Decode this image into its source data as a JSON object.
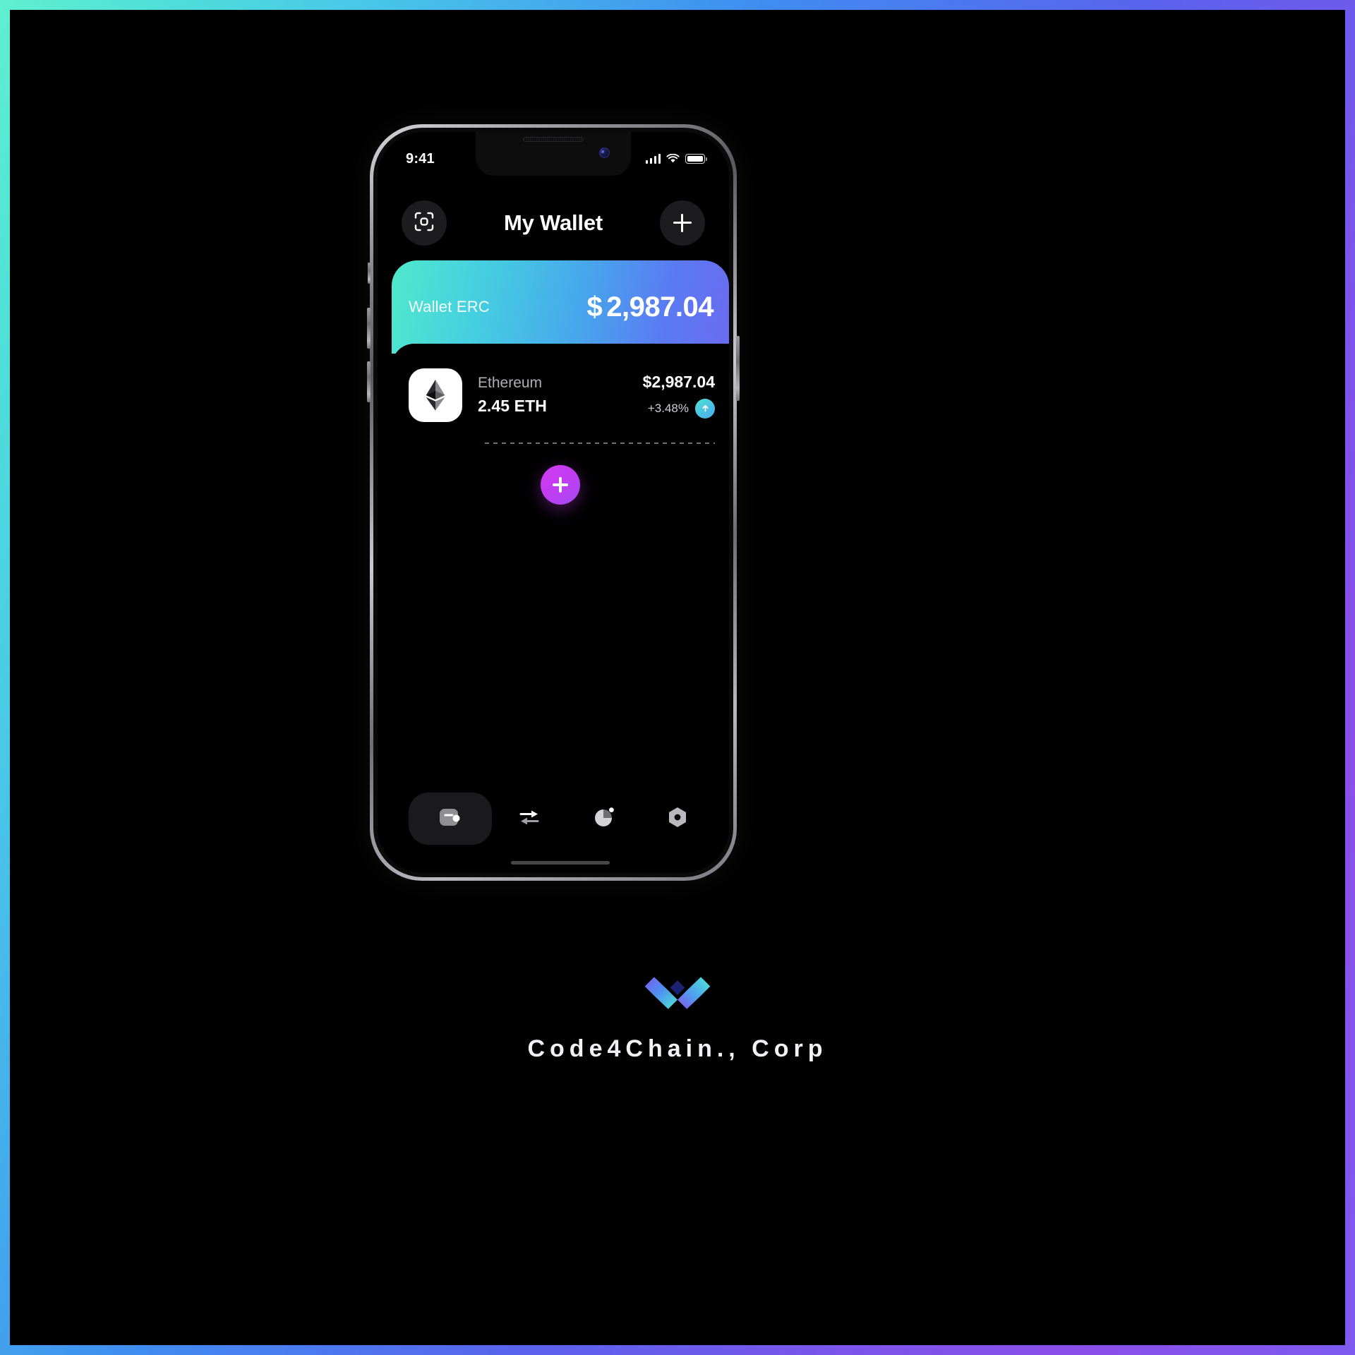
{
  "theme": {
    "frame_gradient_start": "#5ff0d0",
    "frame_gradient_mid": "#3f8ef0",
    "frame_gradient_end": "#8a4fe8",
    "card_gradient_start": "#4fe9cd",
    "card_gradient_end": "#6a6bf0",
    "fab_color": "#c23cf2",
    "screen_bg": "#000000"
  },
  "status_bar": {
    "time": "9:41",
    "signal_icon": "cellular-bars-icon",
    "wifi_icon": "wifi-icon",
    "battery_icon": "battery-full-icon"
  },
  "header": {
    "scan_icon": "scan-qr-icon",
    "title": "My Wallet",
    "add_icon": "plus-icon"
  },
  "wallet_card": {
    "label": "Wallet ERC",
    "currency_symbol": "$",
    "balance": "2,987.04"
  },
  "tokens": [
    {
      "icon": "ethereum-icon",
      "name": "Ethereum",
      "quantity": "2.45 ETH",
      "value": "$2,987.04",
      "change": "+3.48%",
      "change_direction": "up",
      "change_badge_icon": "arrow-up-circle-icon"
    }
  ],
  "add_token_button": {
    "icon": "plus-icon",
    "label": ""
  },
  "tabbar": {
    "items": [
      {
        "name": "wallet",
        "icon": "wallet-icon",
        "active": true
      },
      {
        "name": "swap",
        "icon": "swap-arrows-icon",
        "active": false
      },
      {
        "name": "analytics",
        "icon": "pie-chart-icon",
        "active": false
      },
      {
        "name": "settings",
        "icon": "hexagon-icon",
        "active": false
      }
    ]
  },
  "brand": {
    "logo_icon": "infinity-logo-icon",
    "name": "Code4Chain., Corp"
  }
}
